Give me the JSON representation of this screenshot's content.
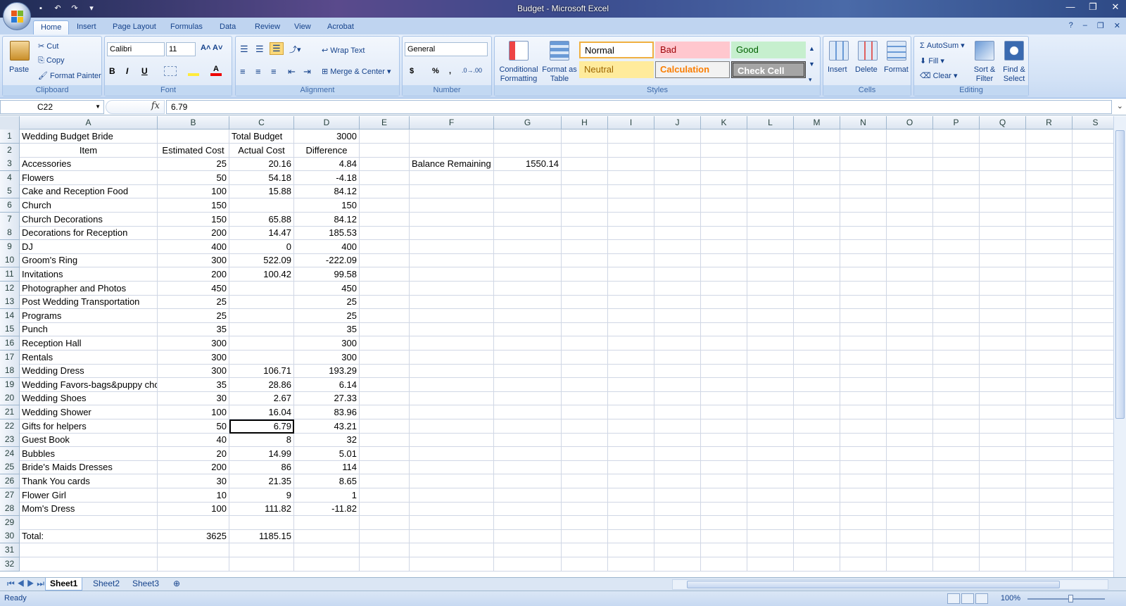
{
  "window": {
    "title": "Budget - Microsoft Excel"
  },
  "tabs": [
    "Home",
    "Insert",
    "Page Layout",
    "Formulas",
    "Data",
    "Review",
    "View",
    "Acrobat"
  ],
  "active_tab": "Home",
  "ribbon": {
    "clipboard": {
      "paste": "Paste",
      "cut": "Cut",
      "copy": "Copy",
      "format_painter": "Format Painter",
      "label": "Clipboard"
    },
    "font": {
      "family": "Calibri",
      "size": "11",
      "bold": "B",
      "italic": "I",
      "underline": "U",
      "label": "Font"
    },
    "alignment": {
      "wrap": "Wrap Text",
      "merge": "Merge & Center",
      "label": "Alignment"
    },
    "number": {
      "format": "General",
      "currency": "$",
      "percent": "%",
      "comma": ",",
      "label": "Number"
    },
    "styles": {
      "conditional": "Conditional Formatting",
      "format_table": "Format as Table",
      "normal": "Normal",
      "bad": "Bad",
      "good": "Good",
      "neutral": "Neutral",
      "calculation": "Calculation",
      "check_cell": "Check Cell",
      "label": "Styles"
    },
    "cells": {
      "insert": "Insert",
      "delete": "Delete",
      "format": "Format",
      "label": "Cells"
    },
    "editing": {
      "autosum": "AutoSum",
      "fill": "Fill",
      "clear": "Clear",
      "sort": "Sort & Filter",
      "find": "Find & Select",
      "label": "Editing"
    }
  },
  "formula_bar": {
    "name_box": "C22",
    "fx": "fx",
    "value": "6.79"
  },
  "columns": [
    "A",
    "B",
    "C",
    "D",
    "E",
    "F",
    "G",
    "H",
    "I",
    "J",
    "K",
    "L",
    "M",
    "N",
    "O",
    "P",
    "Q",
    "R",
    "S"
  ],
  "rows": [
    {
      "n": "1",
      "A": "Wedding Budget Bride",
      "B": "",
      "C": "Total Budget",
      "D": "3000"
    },
    {
      "n": "2",
      "A": "Item",
      "B": "Estimated Cost",
      "C": "Actual Cost",
      "D": "Difference"
    },
    {
      "n": "3",
      "A": "Accessories",
      "B": "25",
      "C": "20.16",
      "D": "4.84",
      "F": "Balance Remaining",
      "G": "1550.14"
    },
    {
      "n": "4",
      "A": "Flowers",
      "B": "50",
      "C": "54.18",
      "D": "-4.18"
    },
    {
      "n": "5",
      "A": "Cake and Reception Food",
      "B": "100",
      "C": "15.88",
      "D": "84.12"
    },
    {
      "n": "6",
      "A": "Church",
      "B": "150",
      "C": "",
      "D": "150"
    },
    {
      "n": "7",
      "A": "Church Decorations",
      "B": "150",
      "C": "65.88",
      "D": "84.12"
    },
    {
      "n": "8",
      "A": "Decorations for Reception",
      "B": "200",
      "C": "14.47",
      "D": "185.53"
    },
    {
      "n": "9",
      "A": "DJ",
      "B": "400",
      "C": "0",
      "D": "400"
    },
    {
      "n": "10",
      "A": "Groom's Ring",
      "B": "300",
      "C": "522.09",
      "D": "-222.09"
    },
    {
      "n": "11",
      "A": "Invitations",
      "B": "200",
      "C": "100.42",
      "D": "99.58"
    },
    {
      "n": "12",
      "A": "Photographer and Photos",
      "B": "450",
      "C": "",
      "D": "450"
    },
    {
      "n": "13",
      "A": "Post Wedding Transportation",
      "B": "25",
      "C": "",
      "D": "25"
    },
    {
      "n": "14",
      "A": "Programs",
      "B": "25",
      "C": "",
      "D": "25"
    },
    {
      "n": "15",
      "A": "Punch",
      "B": "35",
      "C": "",
      "D": "35"
    },
    {
      "n": "16",
      "A": "Reception Hall",
      "B": "300",
      "C": "",
      "D": "300"
    },
    {
      "n": "17",
      "A": "Rentals",
      "B": "300",
      "C": "",
      "D": "300"
    },
    {
      "n": "18",
      "A": "Wedding Dress",
      "B": "300",
      "C": "106.71",
      "D": "193.29"
    },
    {
      "n": "19",
      "A": "Wedding Favors-bags&puppy chow",
      "B": "35",
      "C": "28.86",
      "D": "6.14"
    },
    {
      "n": "20",
      "A": "Wedding Shoes",
      "B": "30",
      "C": "2.67",
      "D": "27.33"
    },
    {
      "n": "21",
      "A": "Wedding Shower",
      "B": "100",
      "C": "16.04",
      "D": "83.96"
    },
    {
      "n": "22",
      "A": "Gifts for helpers",
      "B": "50",
      "C": "6.79",
      "D": "43.21"
    },
    {
      "n": "23",
      "A": "Guest Book",
      "B": "40",
      "C": "8",
      "D": "32"
    },
    {
      "n": "24",
      "A": "Bubbles",
      "B": "20",
      "C": "14.99",
      "D": "5.01"
    },
    {
      "n": "25",
      "A": "Bride's Maids Dresses",
      "B": "200",
      "C": "86",
      "D": "114"
    },
    {
      "n": "26",
      "A": "Thank You cards",
      "B": "30",
      "C": "21.35",
      "D": "8.65"
    },
    {
      "n": "27",
      "A": "Flower Girl",
      "B": "10",
      "C": "9",
      "D": "1"
    },
    {
      "n": "28",
      "A": "Mom's Dress",
      "B": "100",
      "C": "111.82",
      "D": "-11.82"
    },
    {
      "n": "29",
      "A": "",
      "B": "",
      "C": "",
      "D": ""
    },
    {
      "n": "30",
      "A": "Total:",
      "B": "3625",
      "C": "1185.15",
      "D": ""
    },
    {
      "n": "31",
      "A": "",
      "B": "",
      "C": "",
      "D": ""
    },
    {
      "n": "32",
      "A": "",
      "B": "",
      "C": "",
      "D": ""
    }
  ],
  "sheets": [
    "Sheet1",
    "Sheet2",
    "Sheet3"
  ],
  "active_sheet": "Sheet1",
  "status": {
    "text": "Ready",
    "zoom": "100%"
  }
}
